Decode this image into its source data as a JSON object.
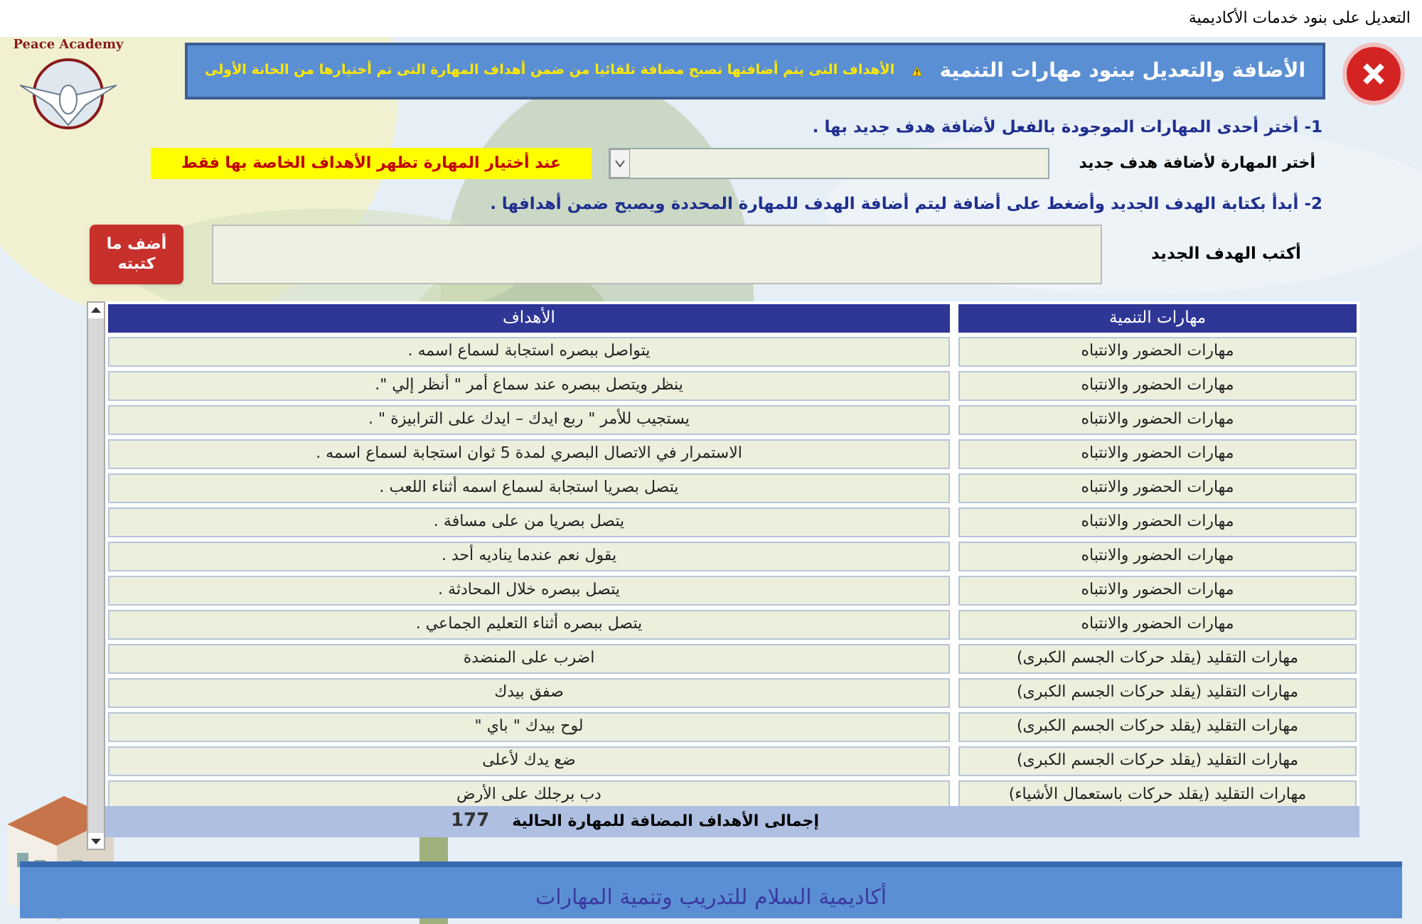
{
  "window": {
    "title": "التعديل على بنود خدمات الأكاديمية"
  },
  "logo": {
    "text": "Peace Academy"
  },
  "banner": {
    "title": "الأضافة والتعديل ببنود مهارات التنمية",
    "notice": "الأهداف التى يتم أضافتها تصبح مضافة تلقائيا من ضمن أهداف المهارة التى تم أختيارها من الخانة الأولى"
  },
  "step1": {
    "instruction": "1- أختر أحدى المهارات الموجودة بالفعل لأضافة هدف جديد بها .",
    "label": "أختر المهارة لأضافة هدف جديد",
    "hint": "عند أختيار المهارة تظهر الأهداف الخاصة بها فقط"
  },
  "step2": {
    "instruction": "2- أبدأ بكتابة الهدف الجديد وأضغط على أضافة ليتم أضافة الهدف للمهارة المحددة ويصبح ضمن أهدافها .",
    "label": "أكتب الهدف الجديد",
    "button": "أضف ما كتبته"
  },
  "table": {
    "columns": [
      "مهارات التنمية",
      "الأهداف"
    ],
    "rows": [
      [
        "مهارات الحضور والانتباه",
        "يتواصل ببصره استجابة لسماع اسمه ."
      ],
      [
        "مهارات الحضور والانتباه",
        "ينظر ويتصل ببصره عند سماع أمر \" أنظر إلي \"."
      ],
      [
        "مهارات الحضور والانتباه",
        "يستجيب للأمر \" ربع ايدك – ايدك على الترابيزة \" ."
      ],
      [
        "مهارات الحضور والانتباه",
        "الاستمرار في الاتصال البصري لمدة 5 ثوان استجابة لسماع اسمه ."
      ],
      [
        "مهارات الحضور والانتباه",
        "يتصل بصريا استجابة لسماع اسمه أثناء اللعب ."
      ],
      [
        "مهارات الحضور والانتباه",
        "يتصل بصريا من على مسافة ."
      ],
      [
        "مهارات الحضور والانتباه",
        "يقول نعم عندما يناديه أحد ."
      ],
      [
        "مهارات الحضور والانتباه",
        "يتصل ببصره خلال المحادثة ."
      ],
      [
        "مهارات الحضور والانتباه",
        "يتصل ببصره أثناء التعليم الجماعي ."
      ],
      [
        "مهارات التقليد (يقلد حركات الجسم الكبرى)",
        "اضرب على المنضدة"
      ],
      [
        "مهارات التقليد (يقلد حركات الجسم الكبرى)",
        "صفق بيدك"
      ],
      [
        "مهارات التقليد (يقلد حركات الجسم الكبرى)",
        "لوح بيدك \" باي \""
      ],
      [
        "مهارات التقليد (يقلد حركات الجسم الكبرى)",
        "ضع يدك لأعلى"
      ],
      [
        "مهارات التقليد (يقلد حركات باستعمال الأشياء)",
        "دب برجلك على الأرض"
      ]
    ],
    "total_label": "إجمالى الأهداف المضافة للمهارة الحالية",
    "total": "177"
  },
  "footer": "أكاديمية السلام للتدريب وتنمية المهارات"
}
